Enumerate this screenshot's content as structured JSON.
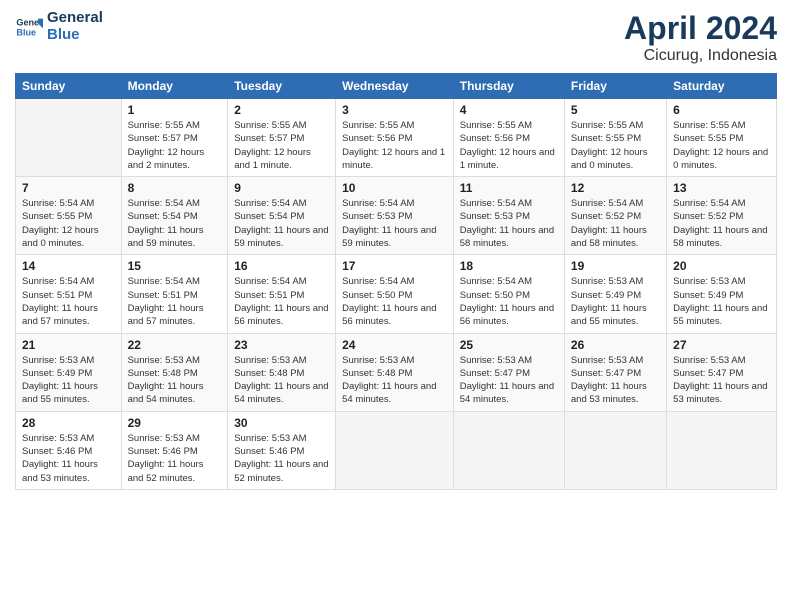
{
  "header": {
    "logo_line1": "General",
    "logo_line2": "Blue",
    "month": "April 2024",
    "location": "Cicurug, Indonesia"
  },
  "weekdays": [
    "Sunday",
    "Monday",
    "Tuesday",
    "Wednesday",
    "Thursday",
    "Friday",
    "Saturday"
  ],
  "weeks": [
    [
      {
        "day": "",
        "sunrise": "",
        "sunset": "",
        "daylight": "",
        "empty": true
      },
      {
        "day": "1",
        "sunrise": "Sunrise: 5:55 AM",
        "sunset": "Sunset: 5:57 PM",
        "daylight": "Daylight: 12 hours and 2 minutes."
      },
      {
        "day": "2",
        "sunrise": "Sunrise: 5:55 AM",
        "sunset": "Sunset: 5:57 PM",
        "daylight": "Daylight: 12 hours and 1 minute."
      },
      {
        "day": "3",
        "sunrise": "Sunrise: 5:55 AM",
        "sunset": "Sunset: 5:56 PM",
        "daylight": "Daylight: 12 hours and 1 minute."
      },
      {
        "day": "4",
        "sunrise": "Sunrise: 5:55 AM",
        "sunset": "Sunset: 5:56 PM",
        "daylight": "Daylight: 12 hours and 1 minute."
      },
      {
        "day": "5",
        "sunrise": "Sunrise: 5:55 AM",
        "sunset": "Sunset: 5:55 PM",
        "daylight": "Daylight: 12 hours and 0 minutes."
      },
      {
        "day": "6",
        "sunrise": "Sunrise: 5:55 AM",
        "sunset": "Sunset: 5:55 PM",
        "daylight": "Daylight: 12 hours and 0 minutes."
      }
    ],
    [
      {
        "day": "7",
        "sunrise": "Sunrise: 5:54 AM",
        "sunset": "Sunset: 5:55 PM",
        "daylight": "Daylight: 12 hours and 0 minutes."
      },
      {
        "day": "8",
        "sunrise": "Sunrise: 5:54 AM",
        "sunset": "Sunset: 5:54 PM",
        "daylight": "Daylight: 11 hours and 59 minutes."
      },
      {
        "day": "9",
        "sunrise": "Sunrise: 5:54 AM",
        "sunset": "Sunset: 5:54 PM",
        "daylight": "Daylight: 11 hours and 59 minutes."
      },
      {
        "day": "10",
        "sunrise": "Sunrise: 5:54 AM",
        "sunset": "Sunset: 5:53 PM",
        "daylight": "Daylight: 11 hours and 59 minutes."
      },
      {
        "day": "11",
        "sunrise": "Sunrise: 5:54 AM",
        "sunset": "Sunset: 5:53 PM",
        "daylight": "Daylight: 11 hours and 58 minutes."
      },
      {
        "day": "12",
        "sunrise": "Sunrise: 5:54 AM",
        "sunset": "Sunset: 5:52 PM",
        "daylight": "Daylight: 11 hours and 58 minutes."
      },
      {
        "day": "13",
        "sunrise": "Sunrise: 5:54 AM",
        "sunset": "Sunset: 5:52 PM",
        "daylight": "Daylight: 11 hours and 58 minutes."
      }
    ],
    [
      {
        "day": "14",
        "sunrise": "Sunrise: 5:54 AM",
        "sunset": "Sunset: 5:51 PM",
        "daylight": "Daylight: 11 hours and 57 minutes."
      },
      {
        "day": "15",
        "sunrise": "Sunrise: 5:54 AM",
        "sunset": "Sunset: 5:51 PM",
        "daylight": "Daylight: 11 hours and 57 minutes."
      },
      {
        "day": "16",
        "sunrise": "Sunrise: 5:54 AM",
        "sunset": "Sunset: 5:51 PM",
        "daylight": "Daylight: 11 hours and 56 minutes."
      },
      {
        "day": "17",
        "sunrise": "Sunrise: 5:54 AM",
        "sunset": "Sunset: 5:50 PM",
        "daylight": "Daylight: 11 hours and 56 minutes."
      },
      {
        "day": "18",
        "sunrise": "Sunrise: 5:54 AM",
        "sunset": "Sunset: 5:50 PM",
        "daylight": "Daylight: 11 hours and 56 minutes."
      },
      {
        "day": "19",
        "sunrise": "Sunrise: 5:53 AM",
        "sunset": "Sunset: 5:49 PM",
        "daylight": "Daylight: 11 hours and 55 minutes."
      },
      {
        "day": "20",
        "sunrise": "Sunrise: 5:53 AM",
        "sunset": "Sunset: 5:49 PM",
        "daylight": "Daylight: 11 hours and 55 minutes."
      }
    ],
    [
      {
        "day": "21",
        "sunrise": "Sunrise: 5:53 AM",
        "sunset": "Sunset: 5:49 PM",
        "daylight": "Daylight: 11 hours and 55 minutes."
      },
      {
        "day": "22",
        "sunrise": "Sunrise: 5:53 AM",
        "sunset": "Sunset: 5:48 PM",
        "daylight": "Daylight: 11 hours and 54 minutes."
      },
      {
        "day": "23",
        "sunrise": "Sunrise: 5:53 AM",
        "sunset": "Sunset: 5:48 PM",
        "daylight": "Daylight: 11 hours and 54 minutes."
      },
      {
        "day": "24",
        "sunrise": "Sunrise: 5:53 AM",
        "sunset": "Sunset: 5:48 PM",
        "daylight": "Daylight: 11 hours and 54 minutes."
      },
      {
        "day": "25",
        "sunrise": "Sunrise: 5:53 AM",
        "sunset": "Sunset: 5:47 PM",
        "daylight": "Daylight: 11 hours and 54 minutes."
      },
      {
        "day": "26",
        "sunrise": "Sunrise: 5:53 AM",
        "sunset": "Sunset: 5:47 PM",
        "daylight": "Daylight: 11 hours and 53 minutes."
      },
      {
        "day": "27",
        "sunrise": "Sunrise: 5:53 AM",
        "sunset": "Sunset: 5:47 PM",
        "daylight": "Daylight: 11 hours and 53 minutes."
      }
    ],
    [
      {
        "day": "28",
        "sunrise": "Sunrise: 5:53 AM",
        "sunset": "Sunset: 5:46 PM",
        "daylight": "Daylight: 11 hours and 53 minutes."
      },
      {
        "day": "29",
        "sunrise": "Sunrise: 5:53 AM",
        "sunset": "Sunset: 5:46 PM",
        "daylight": "Daylight: 11 hours and 52 minutes."
      },
      {
        "day": "30",
        "sunrise": "Sunrise: 5:53 AM",
        "sunset": "Sunset: 5:46 PM",
        "daylight": "Daylight: 11 hours and 52 minutes."
      },
      {
        "day": "",
        "sunrise": "",
        "sunset": "",
        "daylight": "",
        "empty": true
      },
      {
        "day": "",
        "sunrise": "",
        "sunset": "",
        "daylight": "",
        "empty": true
      },
      {
        "day": "",
        "sunrise": "",
        "sunset": "",
        "daylight": "",
        "empty": true
      },
      {
        "day": "",
        "sunrise": "",
        "sunset": "",
        "daylight": "",
        "empty": true
      }
    ]
  ]
}
